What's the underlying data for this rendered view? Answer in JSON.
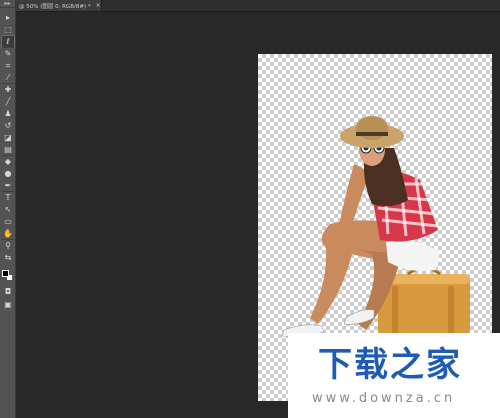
{
  "document_tab": {
    "title": "@ 50% (图层 0, RGB/8#) *",
    "close": "×"
  },
  "toolbar": {
    "grip": "▸▸",
    "tools": [
      {
        "name": "move-tool-icon",
        "glyph": "▸"
      },
      {
        "name": "marquee-tool-icon",
        "glyph": "⬚"
      },
      {
        "name": "lasso-tool-icon",
        "glyph": "ℓ"
      },
      {
        "name": "quick-selection-tool-icon",
        "glyph": "✎"
      },
      {
        "name": "crop-tool-icon",
        "glyph": "⌗"
      },
      {
        "name": "eyedropper-tool-icon",
        "glyph": "⁄"
      },
      {
        "name": "healing-brush-tool-icon",
        "glyph": "✚"
      },
      {
        "name": "brush-tool-icon",
        "glyph": "╱"
      },
      {
        "name": "clone-stamp-tool-icon",
        "glyph": "♟"
      },
      {
        "name": "history-brush-tool-icon",
        "glyph": "↺"
      },
      {
        "name": "eraser-tool-icon",
        "glyph": "◪"
      },
      {
        "name": "gradient-tool-icon",
        "glyph": "▤"
      },
      {
        "name": "blur-tool-icon",
        "glyph": "◆"
      },
      {
        "name": "dodge-tool-icon",
        "glyph": "●"
      },
      {
        "name": "pen-tool-icon",
        "glyph": "✒"
      },
      {
        "name": "type-tool-icon",
        "glyph": "T"
      },
      {
        "name": "path-selection-tool-icon",
        "glyph": "↖"
      },
      {
        "name": "shape-tool-icon",
        "glyph": "▭"
      },
      {
        "name": "hand-tool-icon",
        "glyph": "✋"
      },
      {
        "name": "zoom-tool-icon",
        "glyph": "⚲"
      },
      {
        "name": "swap-colors-icon",
        "glyph": "⇆"
      }
    ],
    "bottom_tools": [
      {
        "name": "quick-mask-icon",
        "glyph": "◘"
      },
      {
        "name": "screen-mode-icon",
        "glyph": "▣"
      }
    ]
  },
  "canvas": {
    "transparency_pattern": "checkerboard",
    "colors": {
      "checker_light": "#ffffff",
      "checker_dark": "#cccccc",
      "workspace": "#282828"
    }
  },
  "watermark": {
    "logo_text": "下载之家",
    "url_text": "www.downza.cn",
    "logo_color": "#1e5bb5"
  }
}
